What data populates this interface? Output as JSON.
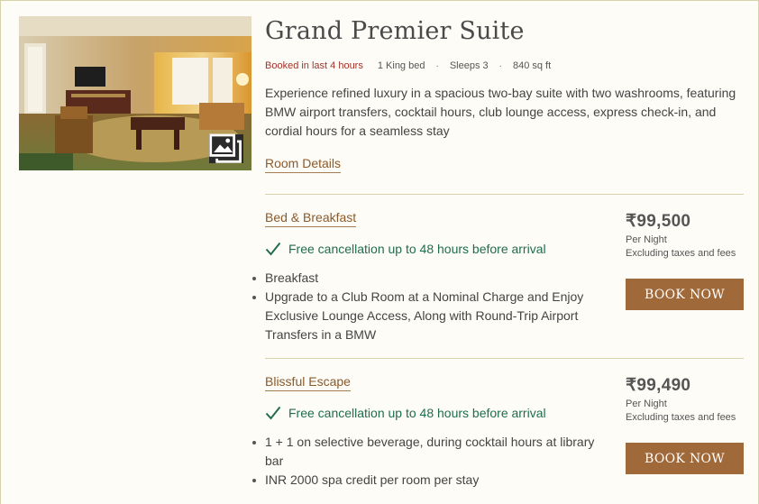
{
  "room": {
    "title": "Grand Premier Suite",
    "booked": "Booked in last 4 hours",
    "bed": "1 King bed",
    "sleeps": "Sleeps 3",
    "area": "840 sq ft",
    "description": "Experience refined luxury in a spacious two-bay suite with two washrooms, featuring BMW airport transfers, cocktail hours, club lounge access, express check-in, and cordial hours for a seamless stay",
    "details_link": "Room Details",
    "image_icon": "gallery-icon",
    "separator": "·"
  },
  "rates": [
    {
      "name": "Bed & Breakfast",
      "cancellation": "Free cancellation up to 48 hours before arrival",
      "inclusions": [
        "Breakfast",
        "Upgrade to a Club Room at a Nominal Charge and Enjoy Exclusive Lounge Access, Along with Round-Trip Airport Transfers in a BMW"
      ],
      "price": "₹99,500",
      "per_night": "Per Night",
      "tax_note": "Excluding taxes and fees",
      "book_label": "BOOK NOW"
    },
    {
      "name": "Blissful Escape",
      "cancellation": "Free cancellation up to 48 hours before arrival",
      "inclusions": [
        "1 + 1 on selective beverage, during cocktail hours at library bar",
        "INR 2000 spa credit per room per stay"
      ],
      "price": "₹99,490",
      "per_night": "Per Night",
      "tax_note": "Excluding taxes and fees",
      "book_label": "BOOK NOW"
    }
  ],
  "colors": {
    "accent": "#8b5a2b",
    "button": "#a0693a",
    "booked": "#a3322b",
    "cancel": "#1f6d4e",
    "background": "#fdfcf6"
  }
}
